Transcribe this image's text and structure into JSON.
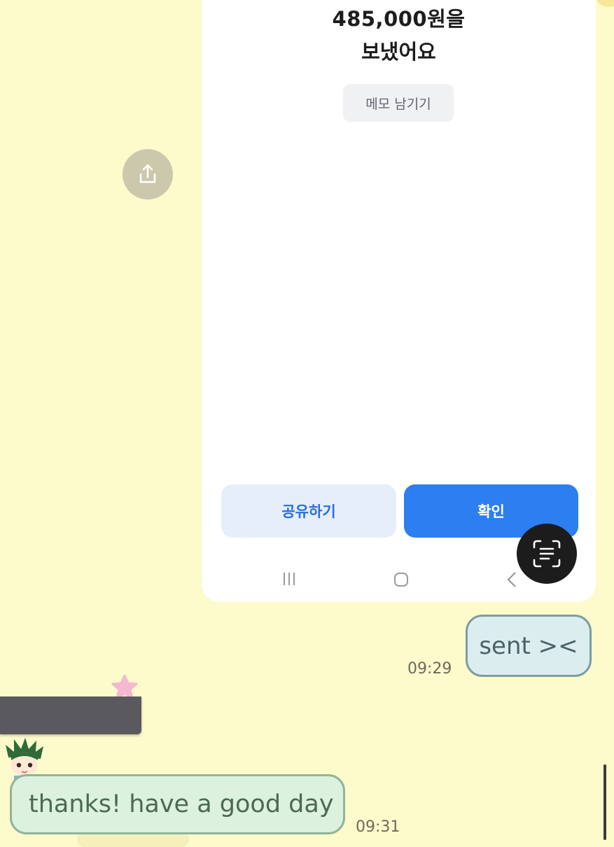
{
  "transfer_screenshot": {
    "amount_text": "485,000원을",
    "sent_text": "보냈어요",
    "memo_button_label": "메모 남기기",
    "share_button_label": "공유하기",
    "confirm_button_label": "확인",
    "nav_icons": [
      "recents-icon",
      "home-icon",
      "back-icon"
    ]
  },
  "messages": [
    {
      "direction": "outgoing",
      "text": "sent ><",
      "time": "09:29"
    },
    {
      "direction": "incoming",
      "text": "thanks! have a good day",
      "time": "09:31"
    }
  ],
  "colors": {
    "chat_background": "#fdfacb",
    "outgoing_bubble": "#dcedf0",
    "incoming_bubble": "#dcf2de",
    "confirm_button": "#2d7ef0",
    "share_button": "#e6eef9"
  }
}
